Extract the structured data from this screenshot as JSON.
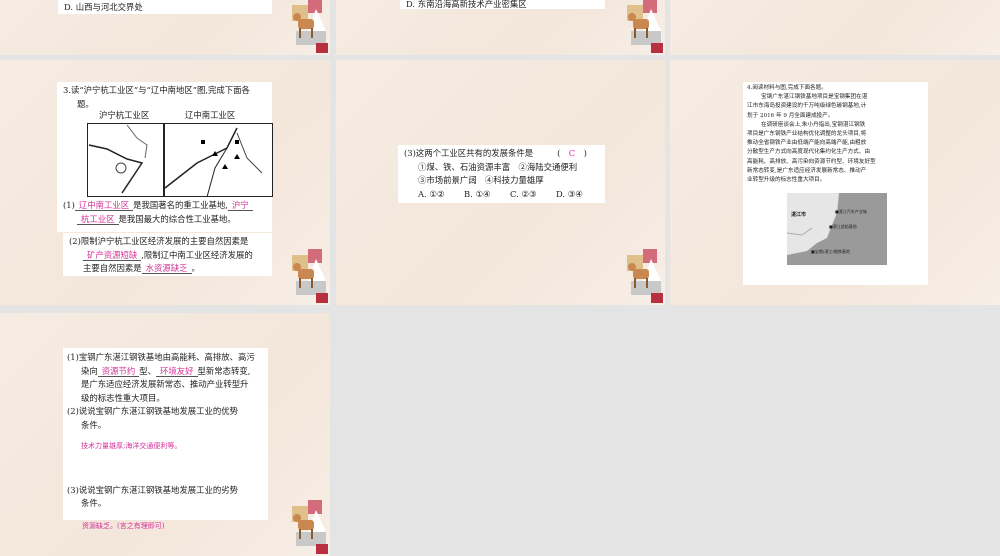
{
  "slides": [
    {
      "id": 1,
      "lines": [
        "D. 山西与河北交界处"
      ]
    },
    {
      "id": 2,
      "lines": [
        "D. 东南沿海高新技术产业密集区"
      ]
    },
    {
      "id": 3
    },
    {
      "id": 4,
      "question": "3.读“沪宁杭工业区”与“辽中南地区”图,完成下面各",
      "question_cont": "题。",
      "map_left_title": "沪宁杭工业区",
      "map_right_title": "辽中南工业区",
      "q1_prefix": "(1)",
      "q1_ans1": "辽中南工业区",
      "q1_mid": "是我国著名的重工业基地,",
      "q1_ans2a": "沪宁",
      "q1_ans2b": "杭工业区",
      "q1_end": "是我国最大的综合性工业基地。",
      "q2_line1": "(2)限制沪宁杭工业区经济发展的主要自然因素是",
      "q2_ans1": "矿产资源短缺",
      "q2_mid": ",限制辽中南工业区经济发展的",
      "q2_line3": "主要自然因素是",
      "q2_ans2": "水资源缺乏",
      "q2_end": "。"
    },
    {
      "id": 5,
      "q3": "(3)这两个工业区共有的发展条件是",
      "q3_answer": "C",
      "opt_line1": "①煤、铁、石油资源丰富　②海陆交通便利",
      "opt_line2": "③市场前景广阔　④科技力量雄厚",
      "choices": [
        "A. ①②",
        "B. ①④",
        "C. ②③",
        "D. ③④"
      ]
    },
    {
      "id": 6,
      "title": "4.阅读材料与图,完成下面各题。",
      "para": [
        "宝钢广东湛江钢铁基地项目是宝钢集团在湛",
        "江市东海岛投资建设的千万吨级绿色碳钢基地,计",
        "划于 2016 年 9 月全面建成投产。",
        "在调研座谈会上,朱小丹指出,宝钢湛江钢铁",
        "项目是广东钢铁产业结构优化调整的龙头项目,将",
        "推动全省钢铁产业由低端产能向高端产能,由粗放",
        "分散型生产方式向高度现代化集约化生产方式、由",
        "高能耗、高排放、高污染向资源节约型、环境友好型",
        "新常态转变,是广东适应经济发展新常态、推动产",
        "业转型升级的标志性重大项目。"
      ],
      "map_labels": {
        "city": "湛江市",
        "a": "湛江汽车产业城",
        "b": "湛江造船基地",
        "c": "宝钢(湛江)钢铁基地"
      }
    },
    {
      "id": 7,
      "q1_l1": "(1)宝钢广东湛江钢铁基地由高能耗、高排放、高污",
      "q1_l2a": "染向",
      "q1_ans1": "资源节约",
      "q1_l2b": "型、",
      "q1_ans2": "环境友好",
      "q1_l2c": "型新常态转变,",
      "q1_l3": "是广东适应经济发展新常态、推动产业转型升",
      "q1_l4": "级的标志性重大项目。",
      "q2_l1": "(2)说说宝钢广东湛江钢铁基地发展工业的优势",
      "q2_l2": "条件。",
      "q2_ans": "技术力量雄厚;海洋交通便利等。",
      "q3_l1": "(3)说说宝钢广东湛江钢铁基地发展工业的劣势",
      "q3_l2": "条件。",
      "q3_ans": "资源缺乏。(言之有理即可)"
    }
  ],
  "colors": {
    "answer": "#d4339a",
    "background": "#e4e4e4"
  }
}
